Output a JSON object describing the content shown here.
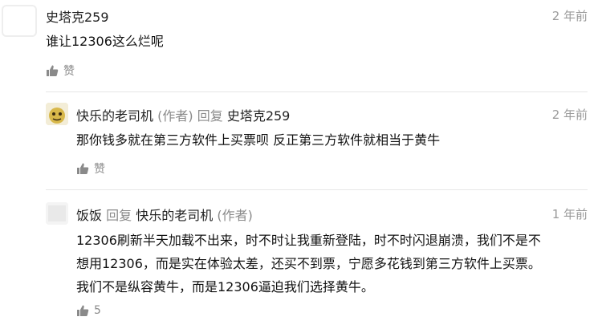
{
  "comments": [
    {
      "author": "史塔克259",
      "time": "2 年前",
      "content": "谁让12306这么烂呢",
      "likes": "赞"
    },
    {
      "author": "快乐的老司机",
      "author_tag": "(作者)",
      "reply_word": "回复",
      "reply_to": "史塔克259",
      "time": "2 年前",
      "content": "那你钱多就在第三方软件上买票呗 反正第三方软件就相当于黄牛",
      "likes": "赞"
    },
    {
      "author": "饭饭",
      "reply_word": "回复",
      "reply_to": "快乐的老司机",
      "reply_to_tag": "(作者)",
      "time": "1 年前",
      "content_lines": [
        "12306刷新半天加载不出来，时不时让我重新登陆，时不时闪退崩溃，我们不是不",
        "想用12306，而是实在体验太差，还买不到票，宁愿多花钱到第三方软件上买票。",
        "我们不是纵容黄牛，而是12306逼迫我们选择黄牛。"
      ],
      "likes": "5"
    }
  ],
  "icons": {
    "like": "thumbs-up-icon"
  },
  "colors": {
    "muted": "#9a9a9a",
    "divider": "#e6e6e6"
  }
}
